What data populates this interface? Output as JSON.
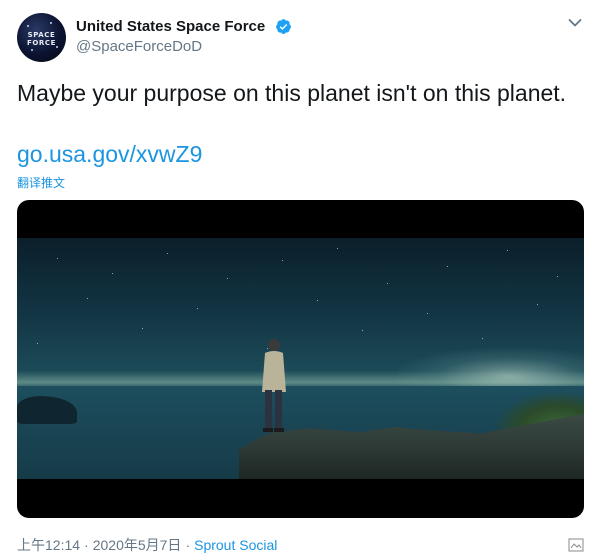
{
  "account": {
    "display_name": "United States Space Force",
    "handle": "@SpaceForceDoD",
    "avatar_text": "SPACE FORCE",
    "verified_icon": "verified-badge-icon",
    "menu_icon": "chevron-down-icon"
  },
  "tweet": {
    "text": "Maybe your purpose on this planet isn't on this planet.",
    "link": "go.usa.gov/xvwZ9",
    "translate_label": "翻译推文"
  },
  "media": {
    "icon": "video-thumbnail"
  },
  "footer": {
    "time": "上午12:14",
    "separator": "·",
    "date": "2020年5月7日",
    "source": "Sprout Social",
    "corner_icon": "watermark-icon"
  },
  "colors": {
    "link": "#1b95e0",
    "secondary_text": "#657786",
    "primary_text": "#14171a",
    "verified": "#1da1f2"
  }
}
